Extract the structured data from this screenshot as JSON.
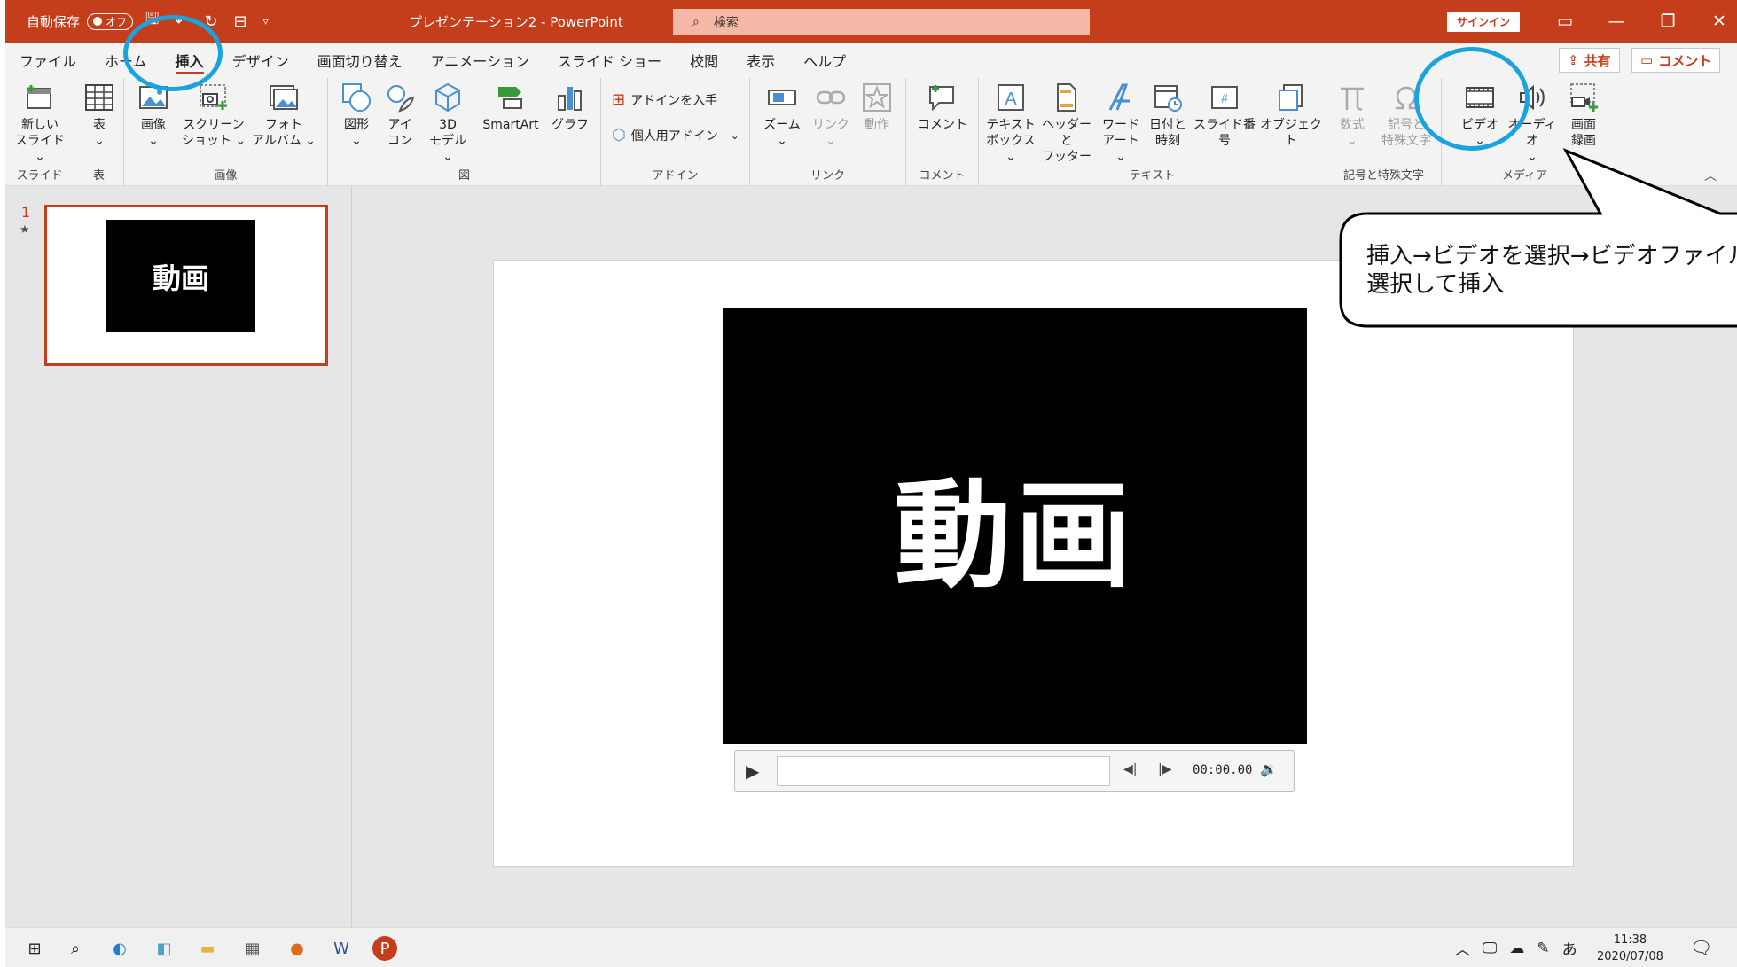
{
  "titlebar": {
    "autosave_label": "自動保存",
    "autosave_state": "オフ",
    "document_title": "プレゼンテーション2 - PowerPoint",
    "search_placeholder": "検索",
    "signin_label": "サインイン",
    "window_controls": [
      "ribbon-display-icon",
      "minimize-icon",
      "restore-icon",
      "close-icon"
    ]
  },
  "tabs": [
    "ファイル",
    "ホーム",
    "挿入",
    "デザイン",
    "画面切り替え",
    "アニメーション",
    "スライド ショー",
    "校閲",
    "表示",
    "ヘルプ"
  ],
  "active_tab": "挿入",
  "share_label": "共有",
  "comment_label": "コメント",
  "ribbon": {
    "groups": {
      "slide": "スライド",
      "table": "表",
      "images": "画像",
      "illustrations": "図",
      "addins": "アドイン",
      "links": "リンク",
      "comments": "コメント",
      "text": "テキスト",
      "symbols": "記号と特殊文字",
      "media": "メディア"
    },
    "buttons": {
      "new_slide": [
        "新しい",
        "スライド ⌄"
      ],
      "table": [
        "表",
        "⌄"
      ],
      "picture": [
        "画像",
        "⌄"
      ],
      "screenshot": [
        "スクリーン",
        "ショット ⌄"
      ],
      "photo_album": [
        "フォト",
        "アルバム ⌄"
      ],
      "shapes": [
        "図形",
        "⌄"
      ],
      "icons": [
        "アイ",
        "コン"
      ],
      "model3d": [
        "3D",
        "モデル ⌄"
      ],
      "smartart": "SmartArt",
      "chart": "グラフ",
      "get_addins": "アドインを入手",
      "my_addins": "個人用アドイン",
      "zoom": [
        "ズーム",
        "⌄"
      ],
      "link": [
        "リンク",
        "⌄"
      ],
      "action": "動作",
      "comment": "コメント",
      "textbox": [
        "テキスト",
        "ボックス ⌄"
      ],
      "header_footer": [
        "ヘッダーと",
        "フッター"
      ],
      "wordart": [
        "ワード",
        "アート ⌄"
      ],
      "datetime": [
        "日付と",
        "時刻"
      ],
      "slide_number": "スライド番号",
      "object": "オブジェクト",
      "equation": [
        "数式",
        "⌄"
      ],
      "symbol": [
        "記号と",
        "特殊文字"
      ],
      "video": [
        "ビデオ",
        "⌄"
      ],
      "audio": [
        "オーディオ",
        "⌄"
      ],
      "screen_recording": [
        "画面",
        "録画"
      ]
    }
  },
  "thumbnail": {
    "number": "1",
    "marker": "★",
    "text": "動画"
  },
  "slide": {
    "video_text": "動画",
    "player_time": "00:00.00"
  },
  "callout_text": "挿入→ビデオを選択→ビデオファイルを\n選択して挿入",
  "taskbar": {
    "apps": [
      "windows-start-icon",
      "search-icon",
      "edge-icon",
      "app-icon",
      "file-explorer-icon",
      "calculator-icon",
      "firefox-icon",
      "word-icon",
      "powerpoint-icon"
    ],
    "ime": "あ",
    "time": "11:38",
    "date": "2020/07/08",
    "notification_count": "1"
  },
  "colors": {
    "accent": "#c43e1c",
    "highlight_circle": "#1aa3de"
  }
}
